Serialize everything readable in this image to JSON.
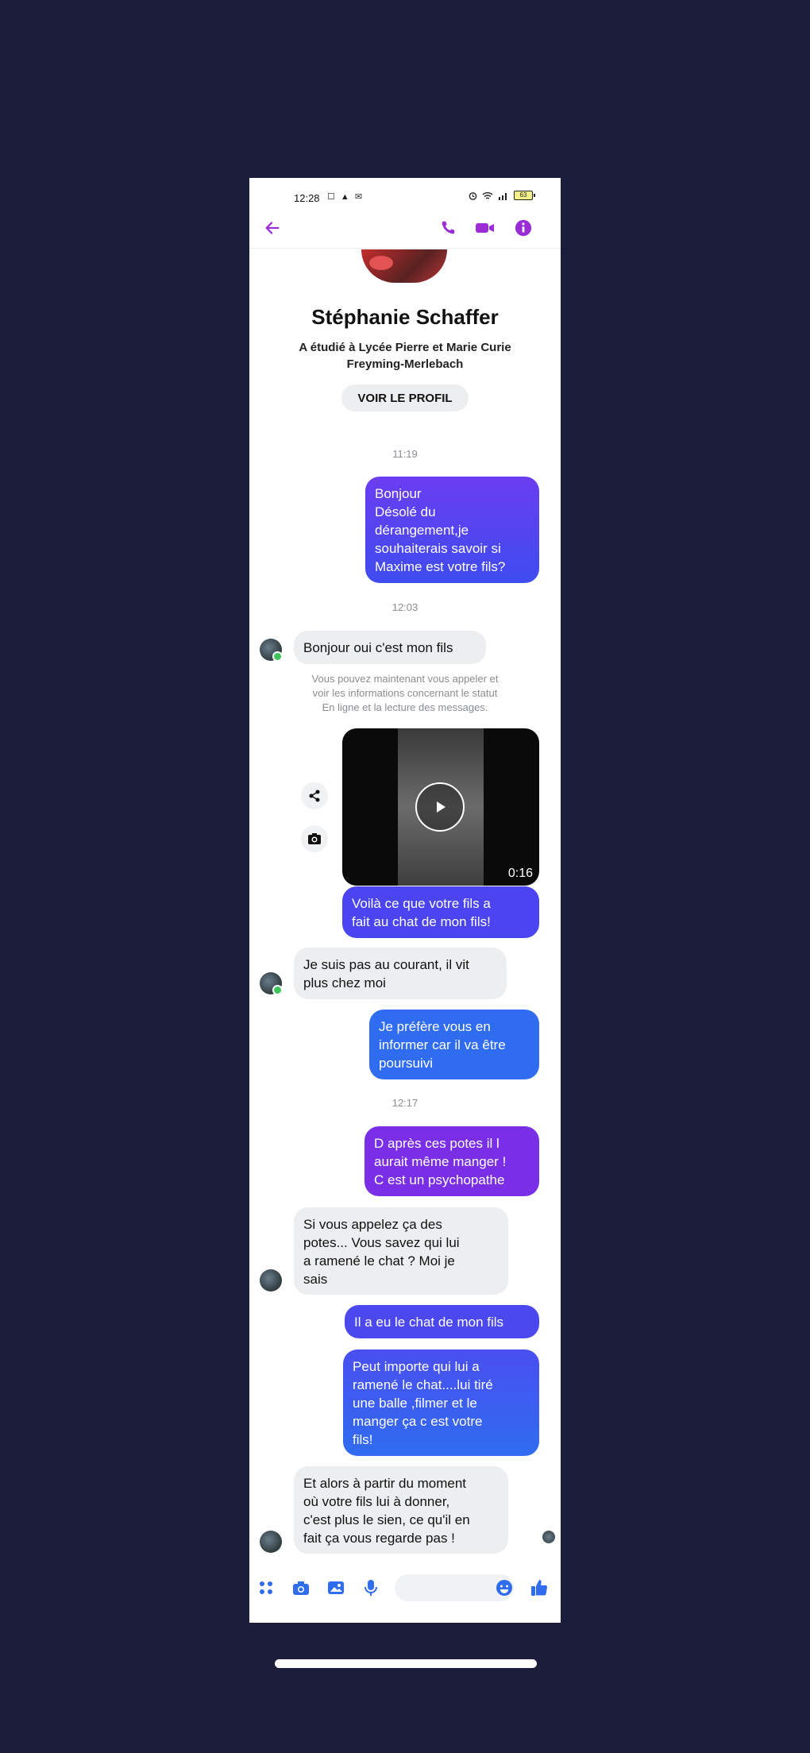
{
  "status_bar": {
    "time": "12:28",
    "left_icons": "☐ ▲ ✉",
    "battery": "63"
  },
  "header": {
    "back_icon": "arrow-left-icon",
    "call_icon": "phone-icon",
    "video_icon": "video-camera-icon",
    "info_icon": "info-icon"
  },
  "profile": {
    "name": "Stéphanie Schaffer",
    "subtitle": "A étudié à Lycée Pierre et Marie Curie\nFreyming-Merlebach",
    "button_label": "VOIR LE PROFIL"
  },
  "timestamps": [
    "11:19",
    "12:03",
    "12:17"
  ],
  "notice": "Vous pouvez maintenant vous appeler et\nvoir les informations concernant le statut\nEn ligne et la lecture des messages.",
  "messages": [
    {
      "from": "me",
      "text": "Bonjour\nDésolé du\ndérangement,je\nsouhaiterais savoir si\nMaxime est votre fils?"
    },
    {
      "from": "them",
      "text": "Bonjour oui c'est mon fils"
    },
    {
      "from": "me",
      "text": "Voilà ce que votre fils a\nfait au chat de mon fils!"
    },
    {
      "from": "them",
      "text": "Je suis pas au courant, il vit\nplus chez moi"
    },
    {
      "from": "me",
      "text": "Je préfère vous en\ninformer car il va être\npoursuivi"
    },
    {
      "from": "me",
      "text": "D après ces potes il l\naurait même manger !\nC est un psychopathe"
    },
    {
      "from": "them",
      "text": "Si vous appelez ça des\npotes... Vous savez qui lui\na ramené le chat ? Moi je\nsais"
    },
    {
      "from": "me",
      "text": "Il a eu le chat de mon fils"
    },
    {
      "from": "me",
      "text": "Peut importe qui lui a\nramené le chat....lui tiré\nune balle ,filmer et le\nmanger ça c est votre\nfils!"
    },
    {
      "from": "them",
      "text": "Et alors à partir du moment\noù votre fils lui à donner,\nc'est plus le sien, ce qu'il en\nfait ça vous regarde pas !"
    }
  ],
  "video": {
    "duration": "0:16"
  },
  "composer": {
    "input_value": "",
    "icons": [
      "apps-icon",
      "camera-icon",
      "gallery-icon",
      "microphone-icon",
      "emoji-icon",
      "thumbs-up-icon"
    ]
  },
  "colors": {
    "accent": "#9b2dd7",
    "bubble_blue": "#2f6cf0",
    "bubble_purple": "#6a3df0",
    "background": "#1b1d3a"
  }
}
